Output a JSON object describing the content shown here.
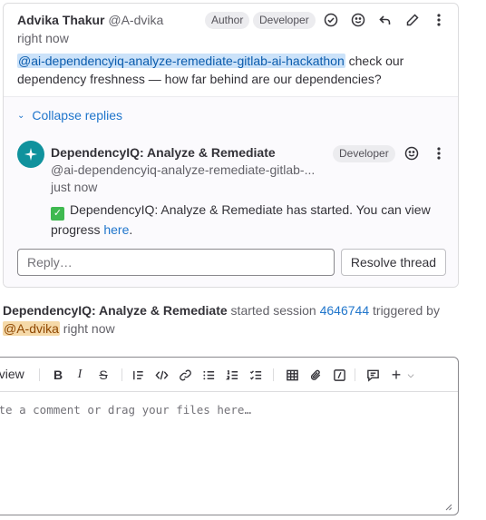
{
  "main_note": {
    "author_name": "Advika Thakur",
    "author_handle": "@A-dvika",
    "time": "right now",
    "badges": [
      "Author",
      "Developer"
    ],
    "mention": "@ai-dependencyiq-analyze-remediate-gitlab-ai-hackathon",
    "body_text": " check our dependency freshness — how far behind are our dependencies?"
  },
  "replies": {
    "collapse_label": "Collapse replies",
    "reply": {
      "author_name": "DependencyIQ: Analyze & Remediate",
      "author_handle": "@ai-dependencyiq-analyze-remediate-gitlab-...",
      "time": "just now",
      "badge": "Developer",
      "body_text": "DependencyIQ: Analyze & Remediate has started. You can view progress ",
      "link_text": "here",
      "body_end": "."
    },
    "reply_placeholder": "Reply…",
    "resolve_label": "Resolve thread"
  },
  "system_note": {
    "actor": "DependencyIQ: Analyze & Remediate",
    "text1": " started session ",
    "session_id": "4646744",
    "text2": " triggered by ",
    "mention": "@A-dvika",
    "time": " right now"
  },
  "editor": {
    "preview_tab": "eview",
    "placeholder": "ite a comment or drag your files here…"
  },
  "colors": {
    "link": "#1f75cb",
    "mention_bg": "#cbe2f9",
    "self_mention_bg": "#f5d9a8",
    "bot_avatar": "#10929d"
  }
}
